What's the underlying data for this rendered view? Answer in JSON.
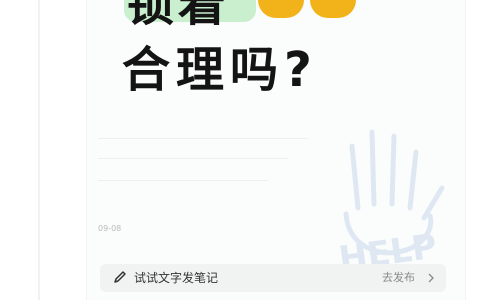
{
  "post": {
    "title_line1": "锁着",
    "title_line2": "合理吗?",
    "date": "09-08"
  },
  "watermark": {
    "text": "HELP"
  },
  "note_bar": {
    "prompt": "试试文字发笔记",
    "publish_label": "去发布"
  },
  "colors": {
    "highlight": "#c9efce",
    "emoji": "#f2b31a",
    "text": "#141414"
  }
}
